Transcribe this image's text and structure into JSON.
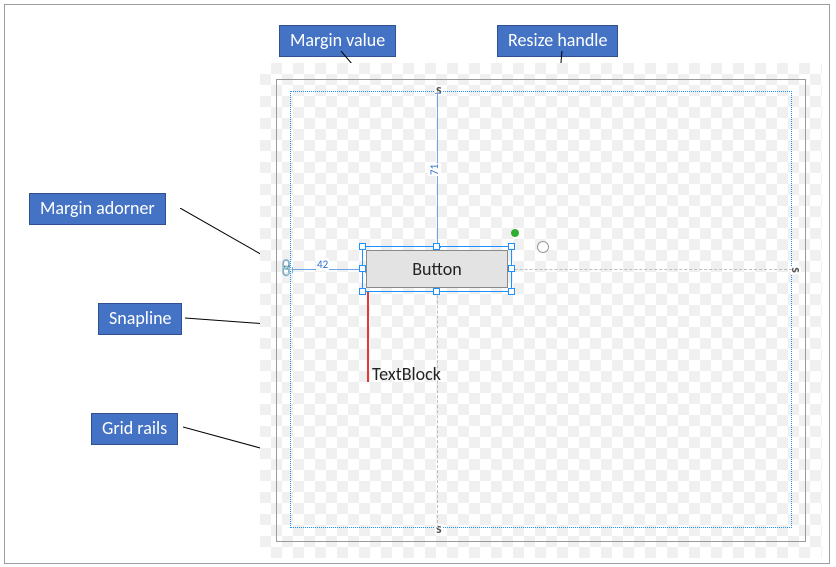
{
  "labels": {
    "margin_value": "Margin value",
    "resize_handle": "Resize handle",
    "margin_adorner": "Margin adorner",
    "snapline": "Snapline",
    "grid_rails": "Grid rails"
  },
  "designer": {
    "button_text": "Button",
    "textblock_text": "TextBlock",
    "margin_left": "42",
    "margin_top": "71"
  }
}
